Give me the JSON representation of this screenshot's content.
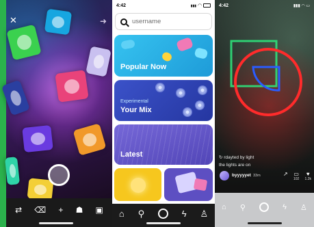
{
  "camera_screen": {
    "close_icon": "close-icon",
    "arrow_icon": "arrow-right-icon",
    "toolbar_icons": [
      "flip-camera-icon",
      "tag-icon",
      "add-icon",
      "ghost-icon",
      "gallery-icon"
    ]
  },
  "explore_screen": {
    "status": {
      "time": "4:42",
      "signal": "▮▮▮",
      "wifi": "wifi-icon",
      "battery": "battery-icon"
    },
    "search": {
      "placeholder": "username"
    },
    "cards": {
      "popular": "Popular Now",
      "mix_line1": "Experimental",
      "mix_line2": "Your Mix",
      "latest": "Latest"
    },
    "nav_icons": [
      "home-icon",
      "search-icon",
      "camera-icon",
      "lightning-icon",
      "person-icon"
    ]
  },
  "post_screen": {
    "status": {
      "time": "4:42"
    },
    "reposted_by": "↻ rdayted by light",
    "caption": "the lights are on",
    "username": "byyyyyet",
    "time_ago": "33m",
    "actions": [
      {
        "icon": "share-icon",
        "count": ""
      },
      {
        "icon": "comment-icon",
        "count": "102"
      },
      {
        "icon": "heart-icon",
        "count": "1.2k"
      }
    ],
    "colors": {
      "neon_green": "#2fe07a",
      "neon_red": "#ff2b2b",
      "neon_blue": "#2a5cff"
    }
  }
}
